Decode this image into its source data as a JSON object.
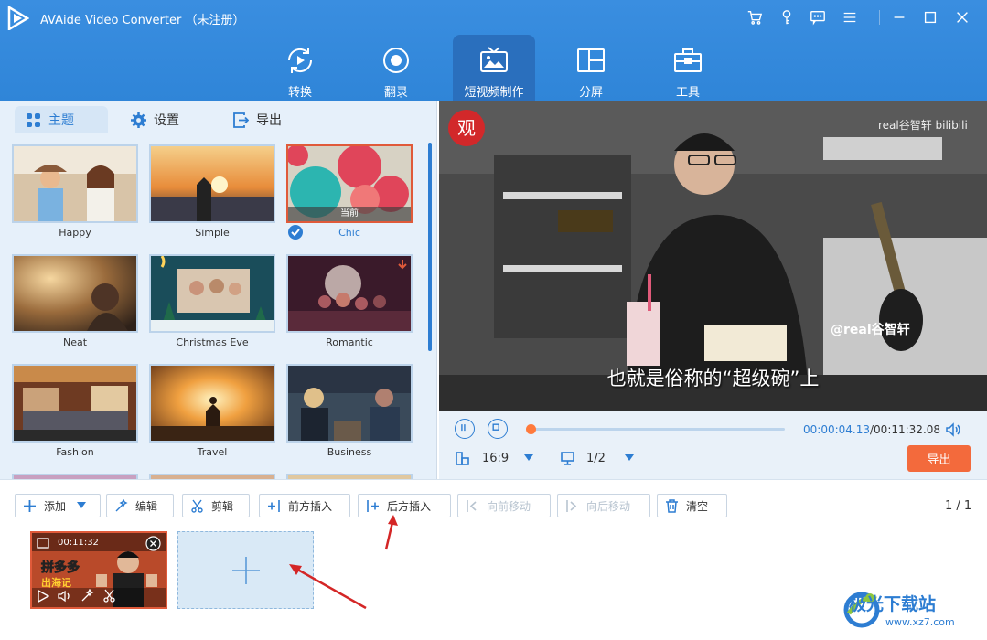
{
  "app": {
    "title": "AVAide Video Converter （未注册）"
  },
  "nav": [
    {
      "label": "转换",
      "icon": "convert-icon"
    },
    {
      "label": "翻录",
      "icon": "rip-icon"
    },
    {
      "label": "短视频制作",
      "icon": "mv-icon",
      "active": true
    },
    {
      "label": "分屏",
      "icon": "collage-icon"
    },
    {
      "label": "工具",
      "icon": "toolbox-icon"
    }
  ],
  "tabs": {
    "theme": "主题",
    "settings": "设置",
    "export": "导出"
  },
  "themes": [
    {
      "label": "Happy"
    },
    {
      "label": "Simple"
    },
    {
      "label": "Chic",
      "selected": true,
      "badge": "当前"
    },
    {
      "label": "Neat"
    },
    {
      "label": "Christmas Eve"
    },
    {
      "label": "Romantic"
    },
    {
      "label": "Fashion"
    },
    {
      "label": "Travel"
    },
    {
      "label": "Business"
    }
  ],
  "video": {
    "subtitle": "也就是俗称的“超级碗”上",
    "watermark": "real谷智轩 bilibili",
    "handle": "@real谷智轩",
    "logo_char": "观"
  },
  "player": {
    "time_current": "00:00:04.13",
    "time_total": "/00:11:32.08",
    "ratio": "16:9",
    "page": "1/2",
    "export": "导出",
    "progress": 0.02
  },
  "toolbar": {
    "add": "添加",
    "edit": "编辑",
    "trim": "剪辑",
    "insert_before": "前方插入",
    "insert_after": "后方插入",
    "move_forward": "向前移动",
    "move_backward": "向后移动",
    "clear": "清空",
    "page": "1 / 1"
  },
  "clip": {
    "duration": "00:11:32",
    "title_text": "拼多多"
  },
  "site": {
    "name": "极光下载站",
    "url": "www.xz7.com"
  },
  "colors": {
    "accent": "#2d7dd2",
    "header": "#3a8ee0",
    "export": "#f36a3c",
    "selected_border": "#e05a3a"
  }
}
